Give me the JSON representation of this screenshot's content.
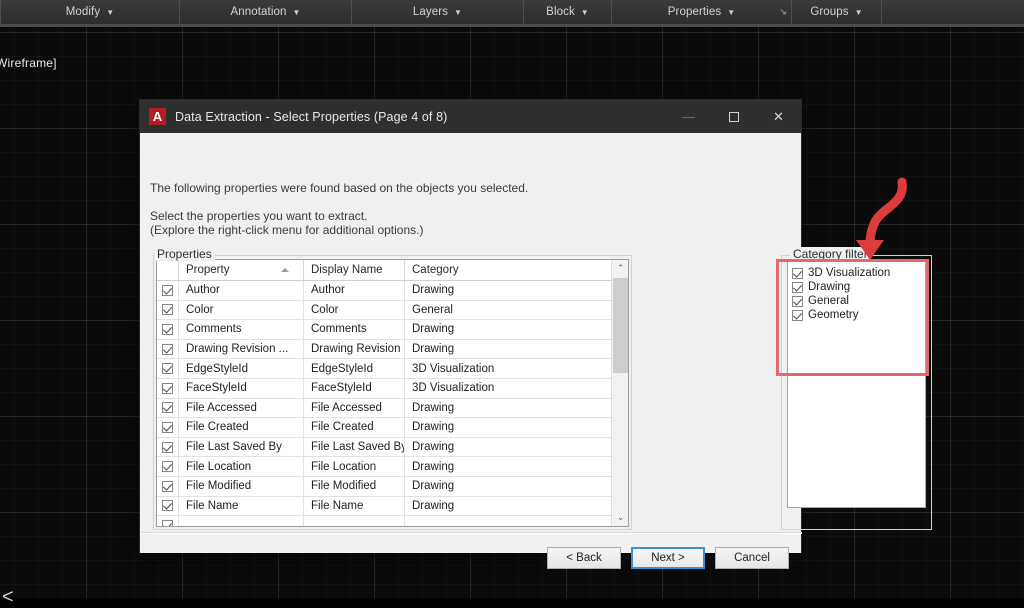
{
  "ribbon": {
    "panels": [
      {
        "label": "Modify",
        "caret": "▼",
        "launcher": ""
      },
      {
        "label": "Annotation",
        "caret": "▼",
        "launcher": ""
      },
      {
        "label": "Layers",
        "caret": "▼",
        "launcher": ""
      },
      {
        "label": "Block",
        "caret": "▼",
        "launcher": ""
      },
      {
        "label": "Properties",
        "caret": "▼",
        "launcher": "↘"
      },
      {
        "label": "Groups",
        "caret": "▼",
        "launcher": ""
      }
    ]
  },
  "canvas": {
    "viewport_label": "Wireframe]",
    "ucs_glyph": "<"
  },
  "dialog": {
    "icon_letter": "A",
    "title": "Data Extraction - Select Properties (Page 4 of 8)",
    "window_controls": {
      "minimize": "—",
      "maximize": "",
      "close": "✕"
    },
    "intro": {
      "line1": "The following properties were found based on the objects you selected.",
      "line2": "Select the properties you want to extract.",
      "line3": "(Explore the right-click menu for additional options.)"
    },
    "properties_group": {
      "label": "Properties",
      "columns": [
        "Property",
        "Display Name",
        "Category"
      ],
      "sort_column": "Property",
      "sort_direction": "ascending",
      "rows": [
        {
          "checked": true,
          "property": "Author",
          "display_name": "Author",
          "category": "Drawing"
        },
        {
          "checked": true,
          "property": "Color",
          "display_name": "Color",
          "category": "General"
        },
        {
          "checked": true,
          "property": "Comments",
          "display_name": "Comments",
          "category": "Drawing"
        },
        {
          "checked": true,
          "property": "Drawing Revision ...",
          "display_name": "Drawing Revision ...",
          "category": "Drawing"
        },
        {
          "checked": true,
          "property": "EdgeStyleId",
          "display_name": "EdgeStyleId",
          "category": "3D Visualization"
        },
        {
          "checked": true,
          "property": "FaceStyleId",
          "display_name": "FaceStyleId",
          "category": "3D Visualization"
        },
        {
          "checked": true,
          "property": "File Accessed",
          "display_name": "File Accessed",
          "category": "Drawing"
        },
        {
          "checked": true,
          "property": "File Created",
          "display_name": "File Created",
          "category": "Drawing"
        },
        {
          "checked": true,
          "property": "File Last Saved By",
          "display_name": "File Last Saved By",
          "category": "Drawing"
        },
        {
          "checked": true,
          "property": "File Location",
          "display_name": "File Location",
          "category": "Drawing"
        },
        {
          "checked": true,
          "property": "File Modified",
          "display_name": "File Modified",
          "category": "Drawing"
        },
        {
          "checked": true,
          "property": "File Name",
          "display_name": "File Name",
          "category": "Drawing"
        },
        {
          "checked": true,
          "property": "",
          "display_name": "",
          "category": ""
        }
      ],
      "scrollbar": {
        "up_arrow": "⌃",
        "down_arrow": "⌄"
      }
    },
    "category_filter": {
      "label": "Category filter",
      "items": [
        {
          "checked": true,
          "label": "3D Visualization"
        },
        {
          "checked": true,
          "label": "Drawing"
        },
        {
          "checked": true,
          "label": "General"
        },
        {
          "checked": true,
          "label": "Geometry"
        }
      ]
    },
    "buttons": {
      "back": "< Back",
      "next": "Next >",
      "cancel": "Cancel"
    }
  },
  "colors": {
    "annotation_red": "#e06a6e",
    "arrow_red": "#dc3c3c",
    "focus_blue": "#3a8fd0",
    "autocad_logo_red": "#b41e21"
  }
}
